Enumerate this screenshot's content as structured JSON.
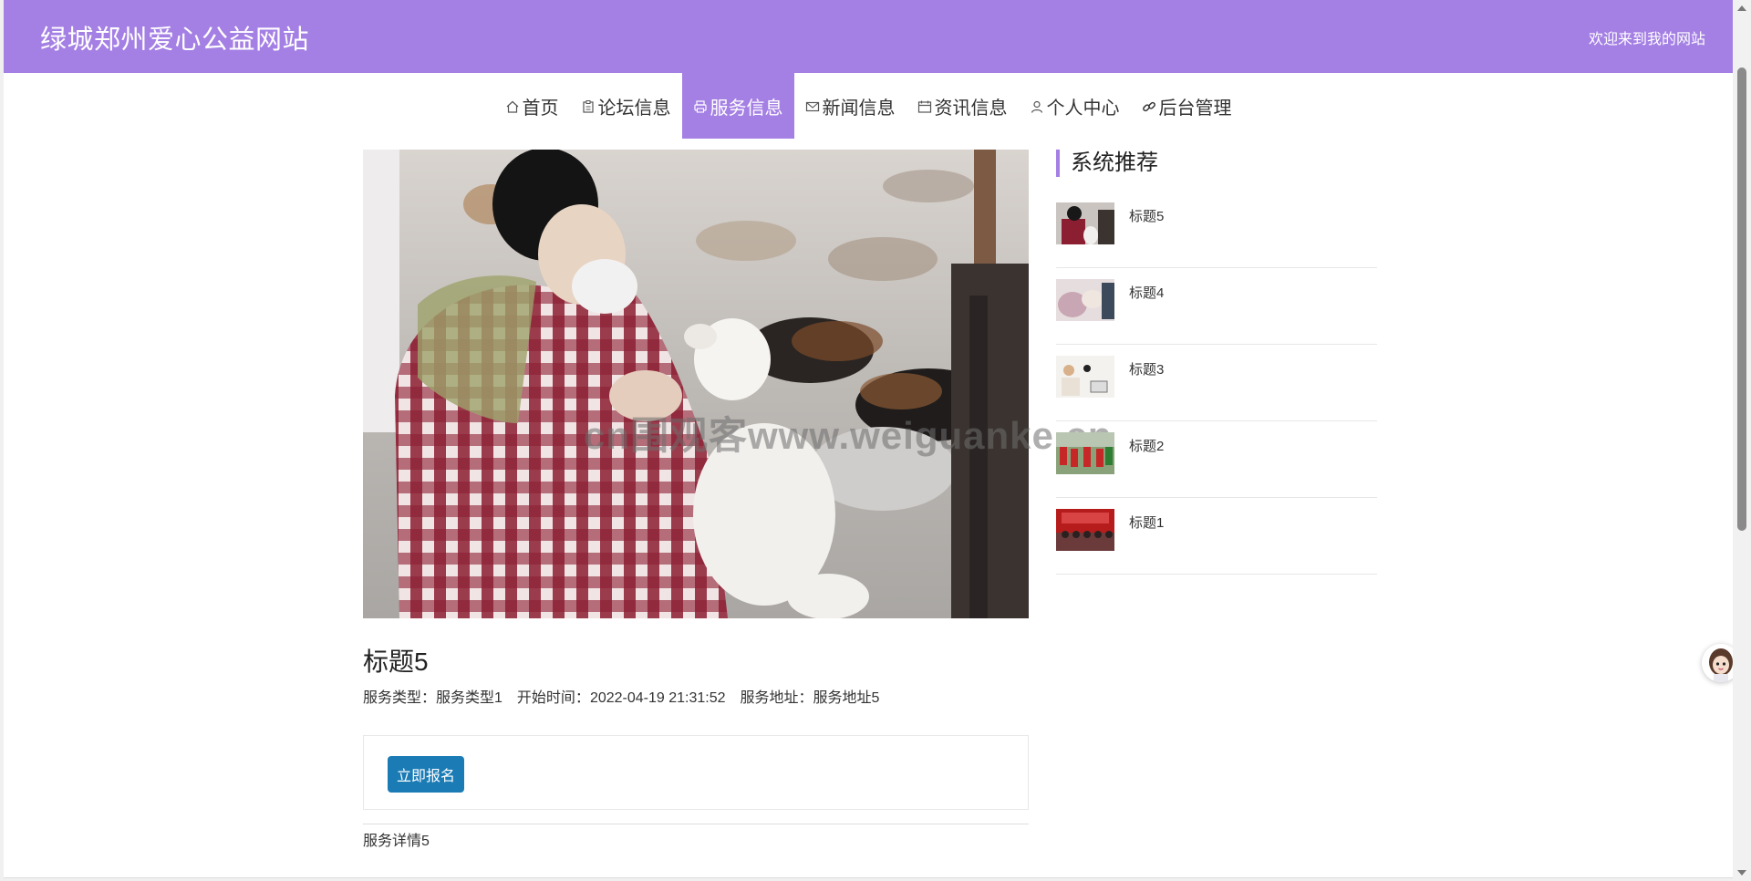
{
  "header": {
    "site_title": "绿城郑州爱心公益网站",
    "welcome": "欢迎来到我的网站"
  },
  "nav": {
    "items": [
      {
        "label": "首页",
        "icon": "home-icon"
      },
      {
        "label": "论坛信息",
        "icon": "clipboard-icon"
      },
      {
        "label": "服务信息",
        "icon": "print-icon",
        "active": true
      },
      {
        "label": "新闻信息",
        "icon": "envelope-icon"
      },
      {
        "label": "资讯信息",
        "icon": "calendar-icon"
      },
      {
        "label": "个人中心",
        "icon": "user-icon"
      },
      {
        "label": "后台管理",
        "icon": "link-icon"
      }
    ]
  },
  "watermark": "cn围观客www.weiguanke.cn",
  "detail": {
    "title": "标题5",
    "meta": {
      "type_key": "服务类型：",
      "type_val": "服务类型1",
      "start_key": "开始时间：",
      "start_val": "2022-04-19 21:31:52",
      "addr_key": "服务地址：",
      "addr_val": "服务地址5"
    },
    "signup_label": "立即报名",
    "body": "服务详情5"
  },
  "sidebar": {
    "title": "系统推荐",
    "items": [
      {
        "label": "标题5"
      },
      {
        "label": "标题4"
      },
      {
        "label": "标题3"
      },
      {
        "label": "标题2"
      },
      {
        "label": "标题1"
      }
    ]
  },
  "colors": {
    "accent": "#a47fe4",
    "button": "#1a7bb5"
  }
}
